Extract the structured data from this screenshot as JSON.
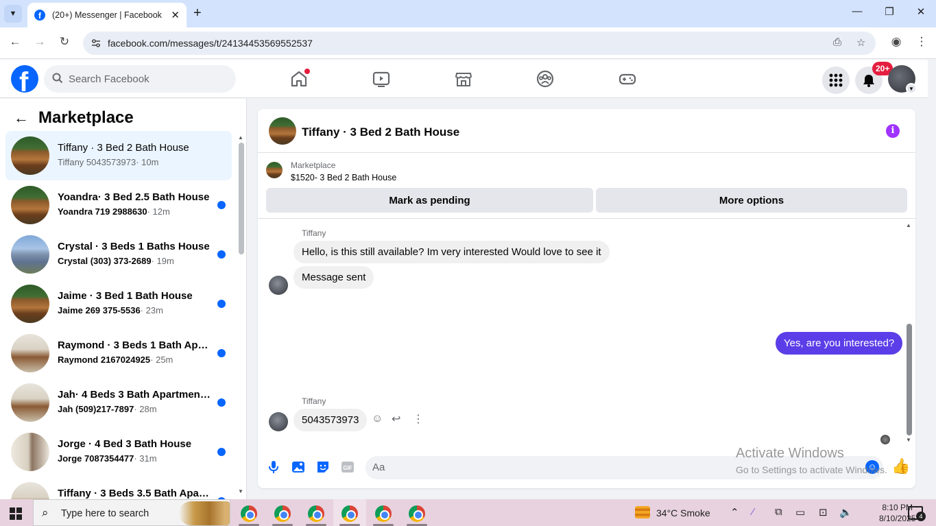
{
  "browser": {
    "tab_title": "(20+) Messenger | Facebook",
    "url": "facebook.com/messages/t/24134453569552537"
  },
  "fb": {
    "search_placeholder": "Search Facebook",
    "notification_count": "20+",
    "nav": [
      "home-icon",
      "video-icon",
      "marketplace-icon",
      "groups-icon",
      "gaming-icon"
    ]
  },
  "left_panel": {
    "title": "Marketplace",
    "conversations": [
      {
        "name": "Tiffany · 3 Bed 2 Bath House",
        "who": "Tiffany 5043573973",
        "time": "· 10m",
        "unread": false,
        "thumb": "cabin"
      },
      {
        "name": "Yoandra· 3 Bed 2.5 Bath House",
        "who": "Yoandra 719 2988630",
        "time": "· 12m",
        "unread": true,
        "thumb": "cabin"
      },
      {
        "name": "Crystal · 3 Beds 1 Baths House",
        "who": "Crystal (303) 373-2689",
        "time": "· 19m",
        "unread": true,
        "thumb": "blue"
      },
      {
        "name": "Jaime · 3 Bed 1 Bath House",
        "who": "Jaime 269 375-5536",
        "time": "· 23m",
        "unread": true,
        "thumb": "cabin"
      },
      {
        "name": "Raymond · 3 Beds 1 Bath Apar...",
        "who": "Raymond 2167024925",
        "time": "· 25m",
        "unread": true,
        "thumb": "interior"
      },
      {
        "name": "Jah· 4 Beds 3 Bath Apartment/...",
        "who": "Jah (509)217-7897",
        "time": "· 28m",
        "unread": true,
        "thumb": "interior"
      },
      {
        "name": "Jorge · 4 Bed 3 Bath House",
        "who": "Jorge 7087354477",
        "time": "· 31m",
        "unread": true,
        "thumb": "hall"
      },
      {
        "name": "Tiffany · 3 Beds 3.5 Bath Apart...",
        "who": "",
        "time": "",
        "unread": true,
        "thumb": "interior"
      }
    ]
  },
  "chat": {
    "title": "Tiffany · 3 Bed 2 Bath House",
    "listing_label": "Marketplace",
    "listing_price": "$1520- 3 Bed 2 Bath House",
    "mark_pending": "Mark as pending",
    "more_options": "More options",
    "sender_1": "Tiffany",
    "msg_1": "Hello, is this still available? Im very interested  Would love to see it",
    "msg_2": "Message sent",
    "msg_out": "Yes, are you interested?",
    "sender_2": "Tiffany",
    "msg_3": "5043573973",
    "composer_placeholder": "Aa"
  },
  "watermark": {
    "line1": "Activate Windows",
    "line2": "Go to Settings to activate Windows."
  },
  "taskbar": {
    "search_placeholder": "Type here to search",
    "weather": "34°C  Smoke",
    "time": "8:10 PM",
    "date": "8/10/2025",
    "notifications": "4"
  },
  "colors": {
    "fb_blue": "#0866ff",
    "outgoing_bubble": "#5b3ee8",
    "unread_dot": "#0866ff",
    "info_icon": "#a033ff"
  }
}
